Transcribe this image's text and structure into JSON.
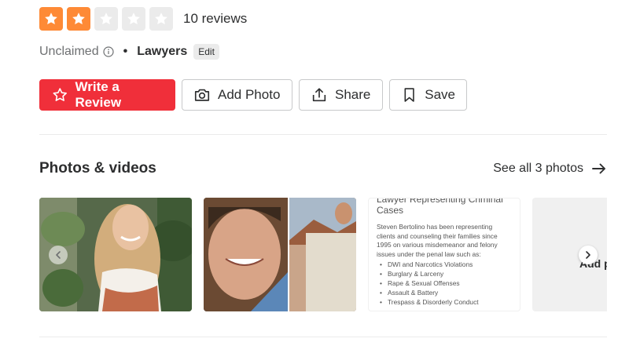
{
  "rating": {
    "stars": [
      {
        "state": "filled",
        "color": "#fe8a36"
      },
      {
        "state": "filled",
        "color": "#fe8a36"
      },
      {
        "state": "empty",
        "color": "#ebebeb"
      },
      {
        "state": "empty",
        "color": "#ebebeb"
      },
      {
        "state": "empty",
        "color": "#ebebeb"
      }
    ],
    "value": 2,
    "max": 5,
    "reviews_label": "10 reviews"
  },
  "meta": {
    "claim_status": "Unclaimed",
    "category": "Lawyers",
    "edit_label": "Edit"
  },
  "actions": {
    "write_review": "Write a Review",
    "add_photo": "Add Photo",
    "share": "Share",
    "save": "Save"
  },
  "photos": {
    "title": "Photos & videos",
    "see_all": "See all 3 photos",
    "document": {
      "title_line1": "Lawyer Representing Criminal",
      "title_line2": "Cases",
      "body": "Steven Bertolino has been representing clients and counseling their families since 1995 on various misdemeanor and felony issues under the penal law such as:",
      "items": [
        "DWI and Narcotics Violations",
        "Burglary & Larceny",
        "Rape & Sexual Offenses",
        "Assault & Battery",
        "Trespass & Disorderly Conduct"
      ]
    },
    "add_tile_label": "Add photo"
  },
  "icons": {
    "star": "star-icon",
    "info": "info-icon",
    "camera": "camera-icon",
    "share": "share-icon",
    "bookmark": "bookmark-icon",
    "arrow_right": "arrow-right-icon",
    "chevron_left": "chevron-left-icon",
    "chevron_right": "chevron-right-icon",
    "add_photo": "add-photo-icon"
  },
  "colors": {
    "brand_red": "#f02f3a",
    "star_orange": "#fe8a36",
    "star_empty": "#ebebeb",
    "text": "#2d2e2f",
    "muted": "#6e7072"
  }
}
